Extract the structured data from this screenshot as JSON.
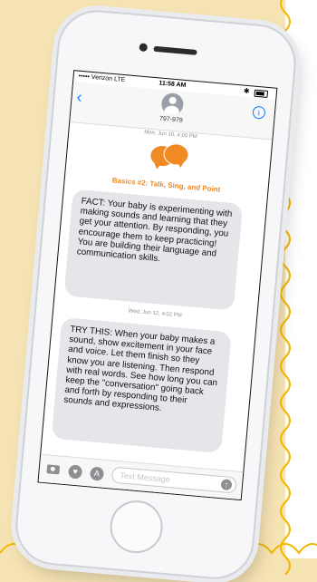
{
  "status_bar": {
    "carrier": "••••• Verizon  LTE",
    "time": "11:58 AM",
    "bluetooth": "✱"
  },
  "header": {
    "back_icon": "‹",
    "contact": "797-979",
    "info_icon": "i"
  },
  "conversation": {
    "date1": "Mon, Jun 10, 4:00 PM",
    "logo_title": "Basics #2: Talk, Sing, and Point",
    "message1": "FACT: Your baby is experimenting with making sounds and learning that they get your attention. By responding, you encourage them to keep practicing! You are building their language and communication skills.",
    "date2": "Wed, Jun 12, 4:02 PM",
    "message2": "TRY THIS: When your baby makes a sound, show excitement in your face and voice. Let them finish so they know you are listening. Then respond with real words. See how long you can keep the \"conversation\" going back and forth by responding to their sounds and expressions."
  },
  "input_bar": {
    "placeholder": "Text Message",
    "heart_icon": "♥",
    "apps_icon": "A",
    "send_icon": "↑"
  },
  "colors": {
    "accent": "#f08a24",
    "ios_blue": "#0a7aff",
    "bubble": "#e5e5ea",
    "background": "#f6e3b4"
  }
}
